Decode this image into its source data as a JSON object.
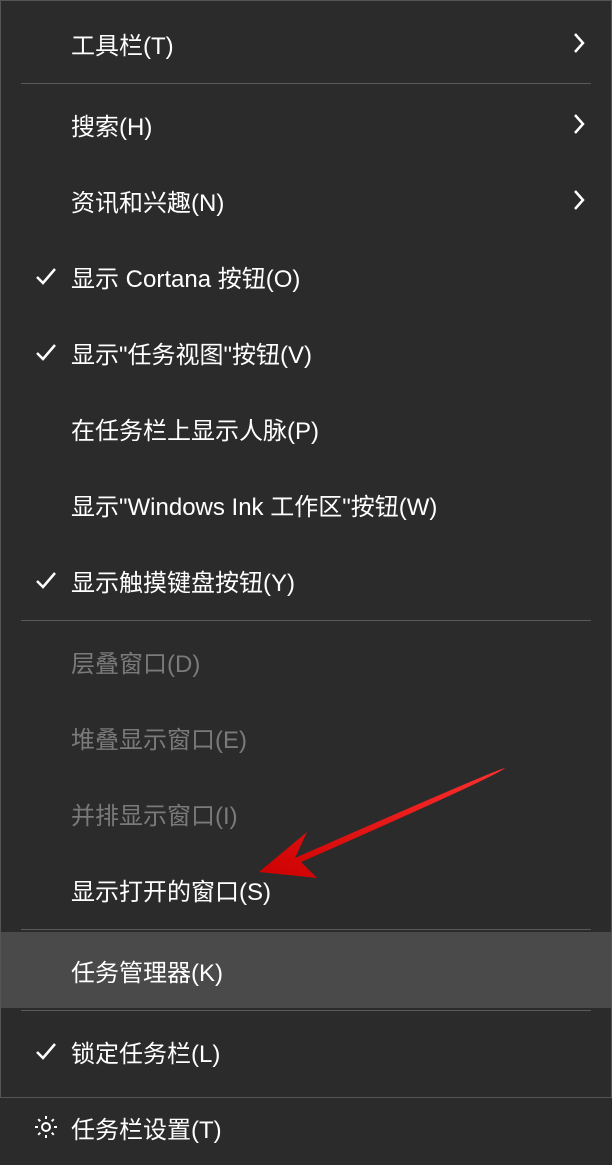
{
  "menu": {
    "items": [
      {
        "id": "toolbars",
        "label": "工具栏(T)",
        "hasSubmenu": true,
        "checked": false,
        "disabled": false
      },
      {
        "id": "separator"
      },
      {
        "id": "search",
        "label": "搜索(H)",
        "hasSubmenu": true,
        "checked": false,
        "disabled": false
      },
      {
        "id": "news",
        "label": "资讯和兴趣(N)",
        "hasSubmenu": true,
        "checked": false,
        "disabled": false
      },
      {
        "id": "cortana",
        "label": "显示 Cortana 按钮(O)",
        "hasSubmenu": false,
        "checked": true,
        "disabled": false
      },
      {
        "id": "taskview",
        "label": "显示\"任务视图\"按钮(V)",
        "hasSubmenu": false,
        "checked": true,
        "disabled": false
      },
      {
        "id": "people",
        "label": "在任务栏上显示人脉(P)",
        "hasSubmenu": false,
        "checked": false,
        "disabled": false
      },
      {
        "id": "ink",
        "label": "显示\"Windows Ink 工作区\"按钮(W)",
        "hasSubmenu": false,
        "checked": false,
        "disabled": false
      },
      {
        "id": "touchkb",
        "label": "显示触摸键盘按钮(Y)",
        "hasSubmenu": false,
        "checked": true,
        "disabled": false
      },
      {
        "id": "separator"
      },
      {
        "id": "cascade",
        "label": "层叠窗口(D)",
        "hasSubmenu": false,
        "checked": false,
        "disabled": true
      },
      {
        "id": "stacked",
        "label": "堆叠显示窗口(E)",
        "hasSubmenu": false,
        "checked": false,
        "disabled": true
      },
      {
        "id": "sidebyside",
        "label": "并排显示窗口(I)",
        "hasSubmenu": false,
        "checked": false,
        "disabled": true
      },
      {
        "id": "showopen",
        "label": "显示打开的窗口(S)",
        "hasSubmenu": false,
        "checked": false,
        "disabled": false
      },
      {
        "id": "separator"
      },
      {
        "id": "taskmgr",
        "label": "任务管理器(K)",
        "hasSubmenu": false,
        "checked": false,
        "disabled": false,
        "highlighted": true
      },
      {
        "id": "separator"
      },
      {
        "id": "lock",
        "label": "锁定任务栏(L)",
        "hasSubmenu": false,
        "checked": true,
        "disabled": false
      },
      {
        "id": "settings",
        "label": "任务栏设置(T)",
        "hasSubmenu": false,
        "checked": false,
        "disabled": false,
        "icon": "gear"
      }
    ]
  },
  "annotation": {
    "type": "arrow",
    "color": "#ff0000"
  }
}
